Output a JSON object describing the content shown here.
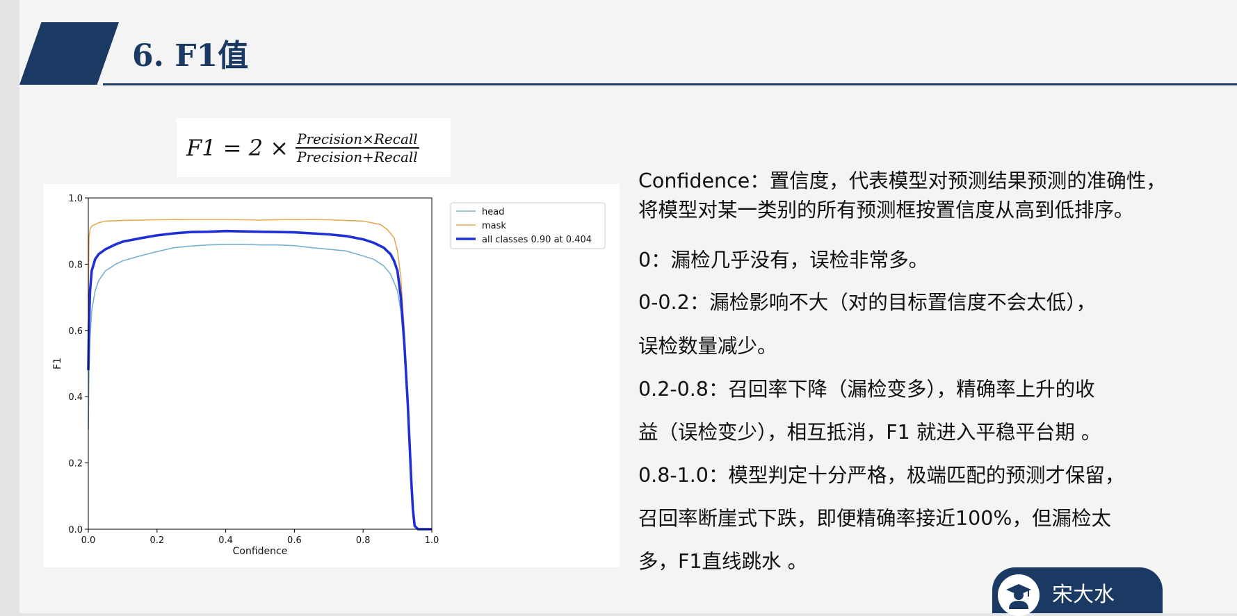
{
  "slide": {
    "title": "6. F1值",
    "formula": {
      "lhs": "F1 = 2 ×",
      "numerator": "Precision×Recall",
      "denominator": "Precision+Recall"
    },
    "paragraphs": [
      "Confidence：置信度，代表模型对预测结果预测的准确性，",
      "将模型对某一类别的所有预测框按置信度从高到低排序。",
      "0：漏检几乎没有，误检非常多。",
      "0-0.2：漏检影响不大（对的目标置信度不会太低），",
      "误检数量减少。",
      "0.2-0.8：召回率下降（漏检变多），精确率上升的收",
      "益（误检变少），相互抵消，F1 就进入平稳平台期 。",
      "0.8-1.0：模型判定十分严格，极端匹配的预测才保留，",
      "召回率断崖式下跌，即便精确率接近100%，但漏检太",
      "多，F1直线跳水 。"
    ],
    "watermark": {
      "name": "宋大水",
      "icon": "graduate-avatar-icon"
    }
  },
  "colors": {
    "brand": "#1b3a63",
    "head": "#7ab0cf",
    "mask": "#e6a852",
    "all": "#1f2fd6"
  },
  "chart_data": {
    "type": "line",
    "xlabel": "Confidence",
    "ylabel": "F1",
    "xlim": [
      0,
      1
    ],
    "ylim": [
      0,
      1
    ],
    "xticks": [
      "0.0",
      "0.2",
      "0.4",
      "0.6",
      "0.8",
      "1.0"
    ],
    "yticks": [
      "0.0",
      "0.2",
      "0.4",
      "0.6",
      "0.8",
      "1.0"
    ],
    "grid": false,
    "legend_position": "outside-top-right",
    "series": [
      {
        "name": "head",
        "color": "#7ab0cf",
        "x": [
          0.0,
          0.002,
          0.005,
          0.01,
          0.02,
          0.03,
          0.05,
          0.08,
          0.1,
          0.15,
          0.2,
          0.25,
          0.3,
          0.35,
          0.4,
          0.45,
          0.5,
          0.55,
          0.6,
          0.65,
          0.7,
          0.75,
          0.8,
          0.83,
          0.86,
          0.88,
          0.9,
          0.91,
          0.92,
          0.93,
          0.94,
          0.945,
          0.95,
          0.96,
          1.0
        ],
        "y": [
          0.3,
          0.48,
          0.58,
          0.66,
          0.72,
          0.75,
          0.78,
          0.8,
          0.81,
          0.825,
          0.838,
          0.85,
          0.855,
          0.858,
          0.86,
          0.86,
          0.858,
          0.858,
          0.856,
          0.85,
          0.845,
          0.84,
          0.825,
          0.815,
          0.795,
          0.77,
          0.72,
          0.66,
          0.55,
          0.38,
          0.15,
          0.06,
          0.01,
          0.0,
          0.0
        ]
      },
      {
        "name": "mask",
        "color": "#e6a852",
        "x": [
          0.0,
          0.002,
          0.005,
          0.01,
          0.02,
          0.03,
          0.05,
          0.1,
          0.2,
          0.3,
          0.4,
          0.5,
          0.6,
          0.7,
          0.8,
          0.85,
          0.87,
          0.89,
          0.9,
          0.91,
          0.92,
          0.93,
          0.94,
          0.945,
          0.95,
          0.96,
          1.0
        ],
        "y": [
          0.7,
          0.88,
          0.905,
          0.915,
          0.92,
          0.925,
          0.93,
          0.932,
          0.934,
          0.935,
          0.935,
          0.933,
          0.935,
          0.934,
          0.93,
          0.92,
          0.905,
          0.88,
          0.84,
          0.76,
          0.6,
          0.38,
          0.14,
          0.05,
          0.01,
          0.0,
          0.0
        ]
      },
      {
        "name": "all classes 0.90 at 0.404",
        "color": "#1f2fd6",
        "x": [
          0.0,
          0.002,
          0.005,
          0.01,
          0.02,
          0.03,
          0.05,
          0.08,
          0.1,
          0.15,
          0.2,
          0.25,
          0.3,
          0.35,
          0.4,
          0.45,
          0.5,
          0.55,
          0.6,
          0.65,
          0.7,
          0.75,
          0.8,
          0.83,
          0.86,
          0.88,
          0.89,
          0.9,
          0.91,
          0.92,
          0.93,
          0.94,
          0.945,
          0.95,
          0.96,
          1.0
        ],
        "y": [
          0.48,
          0.62,
          0.72,
          0.78,
          0.815,
          0.83,
          0.845,
          0.86,
          0.868,
          0.878,
          0.887,
          0.893,
          0.897,
          0.898,
          0.9,
          0.899,
          0.898,
          0.897,
          0.896,
          0.893,
          0.89,
          0.885,
          0.875,
          0.865,
          0.85,
          0.83,
          0.81,
          0.78,
          0.7,
          0.56,
          0.38,
          0.15,
          0.06,
          0.01,
          0.0,
          0.0
        ]
      }
    ]
  }
}
